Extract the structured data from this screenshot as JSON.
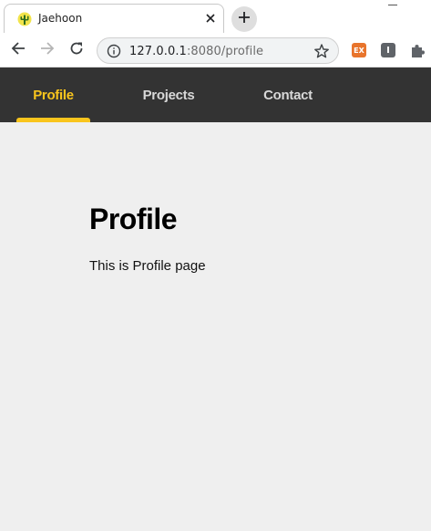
{
  "browser": {
    "tab": {
      "title": "Jaehoon",
      "favicon": "cactus-icon"
    },
    "new_tab_icon": "plus-icon",
    "toolbar": {
      "back_icon": "arrow-left-icon",
      "forward_icon": "arrow-right-icon",
      "reload_icon": "reload-icon",
      "url_host": "127.0.0.1",
      "url_rest": ":8080/profile",
      "info_icon": "info-icon",
      "bookmark_icon": "star-icon",
      "extensions": [
        {
          "label": "EX",
          "color": "#e8742c"
        },
        {
          "label": "I",
          "color": "#5f6368"
        }
      ],
      "extensions_menu_icon": "puzzle-icon"
    }
  },
  "site_nav": {
    "background": "#333333",
    "accent": "#f9c51d",
    "items": [
      {
        "label": "Profile",
        "active": true
      },
      {
        "label": "Projects",
        "active": false
      },
      {
        "label": "Contact",
        "active": false
      }
    ]
  },
  "main": {
    "title": "Profile",
    "text": "This is Profile page"
  }
}
